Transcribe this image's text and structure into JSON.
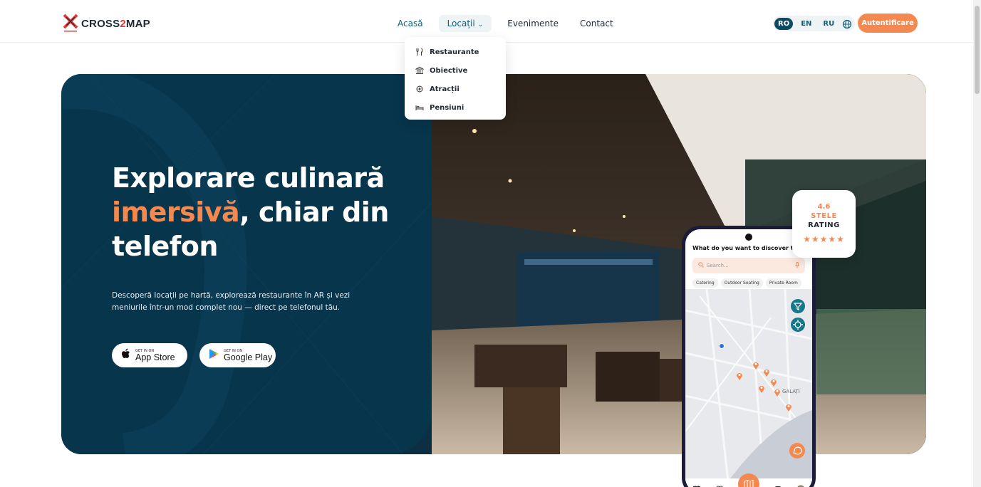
{
  "brand": {
    "name_part1": "CROSS",
    "name_part2": "2",
    "name_part3": "MAP"
  },
  "nav": {
    "items": [
      {
        "label": "Acasă"
      },
      {
        "label": "Locații"
      },
      {
        "label": "Evenimente"
      },
      {
        "label": "Contact"
      }
    ],
    "dropdown": [
      {
        "label": "Restaurante",
        "icon": "fork-knife-icon"
      },
      {
        "label": "Obiective",
        "icon": "landmark-icon"
      },
      {
        "label": "Atracții",
        "icon": "ferris-wheel-icon"
      },
      {
        "label": "Pensiuni",
        "icon": "bed-icon"
      }
    ]
  },
  "languages": {
    "items": [
      "RO",
      "EN",
      "RU"
    ],
    "selected": "RO"
  },
  "auth_button": "Autentificare",
  "hero": {
    "title_line1": "Explorare culinară",
    "title_accent": "imersivă",
    "title_rest": ", chiar din",
    "title_line3": "telefon",
    "description": "Descoperă locații pe hartă, explorează restaurante în AR și vezi meniurile într-un mod complet nou — direct pe telefonul tău.",
    "app_store": {
      "small": "GET IN ON",
      "big": "App Store"
    },
    "google_play": {
      "small": "GET IN ON",
      "big": "Google Play"
    }
  },
  "phone": {
    "question": "What do you want to discover today?",
    "search_placeholder": "Search...",
    "chips": [
      "Catering",
      "Outdoor Seating",
      "Private Room"
    ],
    "map_city": "GALAȚI"
  },
  "rating": {
    "value": "4.6",
    "unit": "STELE",
    "label": "RATING",
    "stars": "★★★★★"
  },
  "colors": {
    "accent": "#f5884e",
    "primary": "#07354c",
    "nav_active": "#0f5f7a"
  }
}
